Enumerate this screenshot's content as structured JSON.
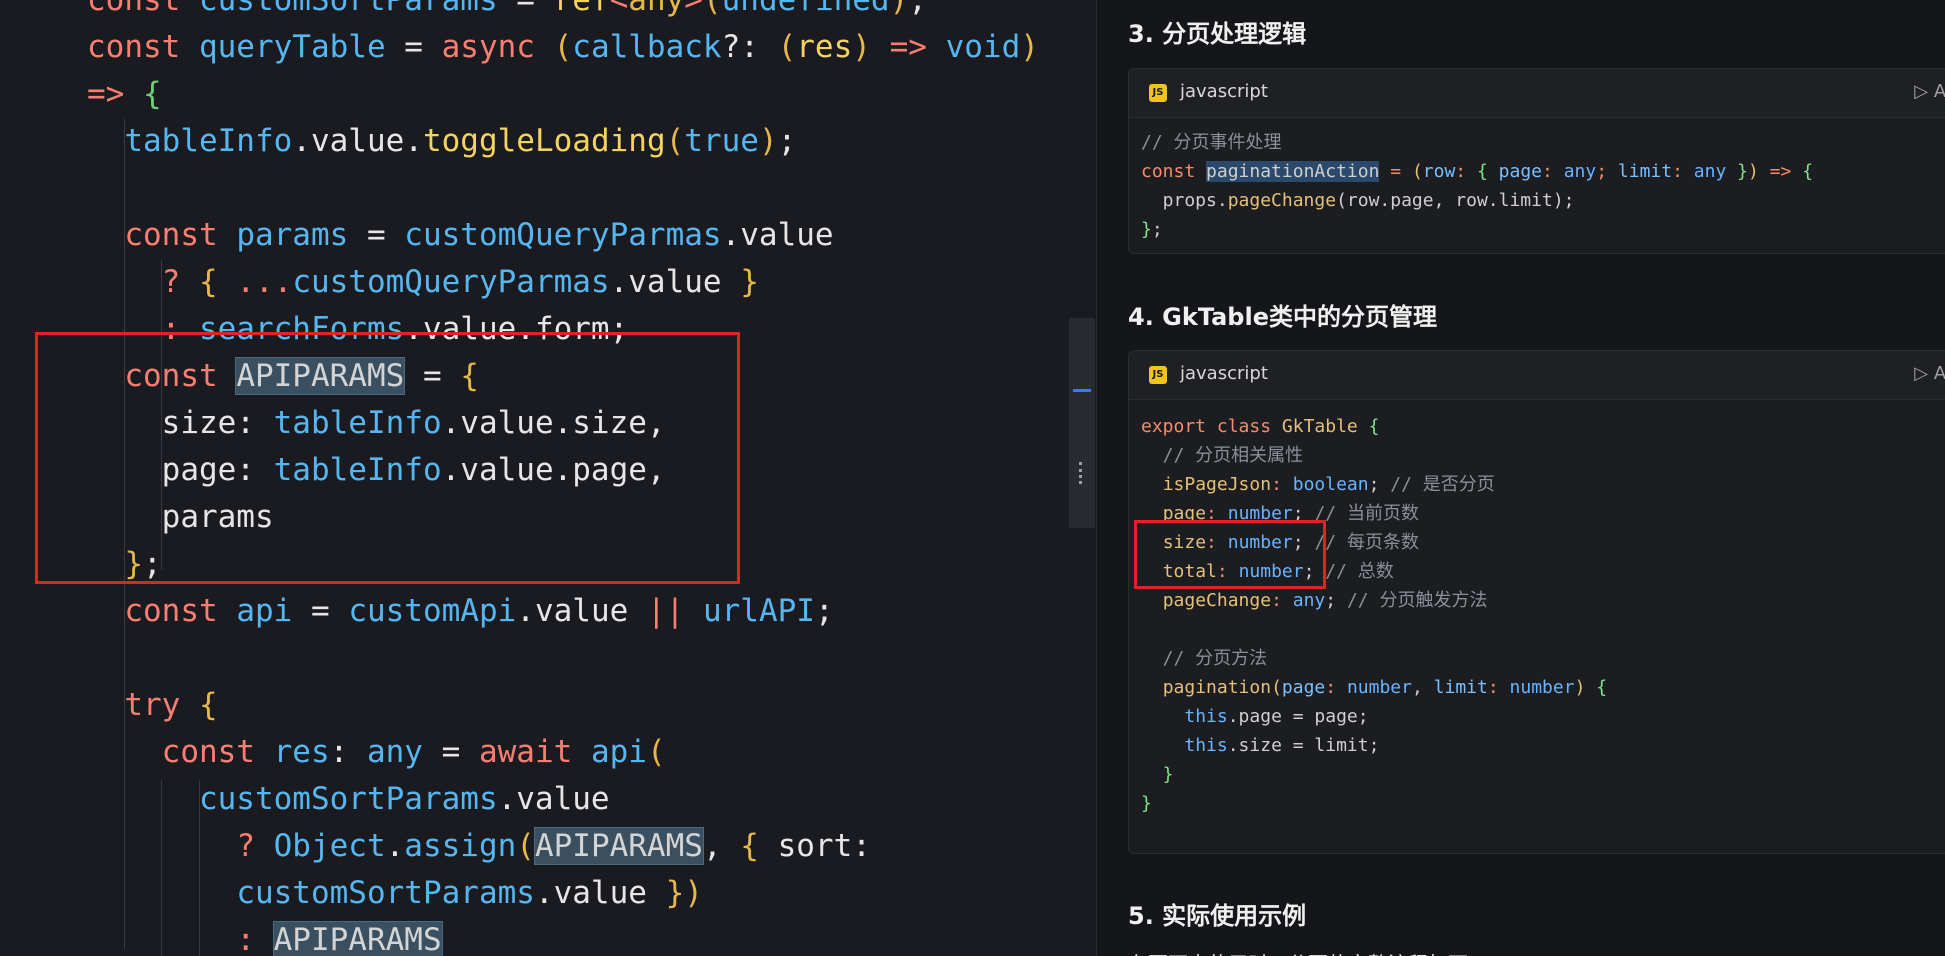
{
  "editor": {
    "lines": [
      [
        [
          "kw",
          "const "
        ],
        [
          "blue",
          "customSortParams"
        ],
        [
          "wh",
          " = "
        ],
        [
          "yel",
          "ref"
        ],
        [
          "kw",
          "<"
        ],
        [
          "gold",
          "any"
        ],
        [
          "kw",
          ">"
        ],
        [
          "gold",
          "("
        ],
        [
          "blue",
          "undefined"
        ],
        [
          "gold",
          ")"
        ],
        [
          "wh",
          ";"
        ]
      ],
      [
        [
          "kw",
          "const "
        ],
        [
          "blue",
          "queryTable"
        ],
        [
          "wh",
          " = "
        ],
        [
          "kw",
          "async "
        ],
        [
          "gold",
          "("
        ],
        [
          "blue",
          "callback"
        ],
        [
          "wh",
          "?: "
        ],
        [
          "gold",
          "("
        ],
        [
          "yel",
          "res"
        ],
        [
          "gold",
          ")"
        ],
        [
          "kw",
          " => "
        ],
        [
          "blue",
          "void"
        ],
        [
          "gold",
          ")"
        ]
      ],
      [
        [
          "kw",
          "=> "
        ],
        [
          "green",
          "{"
        ]
      ],
      [
        [
          "wh",
          "  "
        ],
        [
          "blue",
          "tableInfo"
        ],
        [
          "wh",
          "."
        ],
        [
          "wh",
          "value"
        ],
        [
          "wh",
          "."
        ],
        [
          "yel",
          "toggleLoading"
        ],
        [
          "gold",
          "("
        ],
        [
          "blue",
          "true"
        ],
        [
          "gold",
          ")"
        ],
        [
          "wh",
          ";"
        ]
      ],
      [],
      [
        [
          "wh",
          "  "
        ],
        [
          "kw",
          "const "
        ],
        [
          "blue",
          "params"
        ],
        [
          "wh",
          " = "
        ],
        [
          "blue",
          "customQueryParmas"
        ],
        [
          "wh",
          ".value"
        ]
      ],
      [
        [
          "wh",
          "    "
        ],
        [
          "kw",
          "? "
        ],
        [
          "gold",
          "{ "
        ],
        [
          "kw",
          "..."
        ],
        [
          "blue",
          "customQueryParmas"
        ],
        [
          "wh",
          ".value "
        ],
        [
          "gold",
          "}"
        ]
      ],
      [
        [
          "wh",
          "    "
        ],
        [
          "kw",
          ": "
        ],
        [
          "blue",
          "searchForms"
        ],
        [
          "wh",
          ".value.form;"
        ]
      ],
      [
        [
          "wh",
          "  "
        ],
        [
          "kw",
          "const "
        ],
        [
          "hl-box",
          "APIPARAMS"
        ],
        [
          "wh",
          " = "
        ],
        [
          "gold",
          "{"
        ]
      ],
      [
        [
          "wh",
          "    "
        ],
        [
          "wh",
          "size: "
        ],
        [
          "blue",
          "tableInfo"
        ],
        [
          "wh",
          ".value.size,"
        ]
      ],
      [
        [
          "wh",
          "    "
        ],
        [
          "wh",
          "page: "
        ],
        [
          "blue",
          "tableInfo"
        ],
        [
          "wh",
          ".value.page,"
        ]
      ],
      [
        [
          "wh",
          "    "
        ],
        [
          "wh",
          "params"
        ]
      ],
      [
        [
          "wh",
          "  "
        ],
        [
          "gold",
          "}"
        ],
        [
          "wh",
          ";"
        ]
      ],
      [
        [
          "wh",
          "  "
        ],
        [
          "kw",
          "const "
        ],
        [
          "blue",
          "api"
        ],
        [
          "wh",
          " = "
        ],
        [
          "blue",
          "customApi"
        ],
        [
          "wh",
          ".value "
        ],
        [
          "kw",
          "|| "
        ],
        [
          "blue",
          "urlAPI"
        ],
        [
          "wh",
          ";"
        ]
      ],
      [],
      [
        [
          "wh",
          "  "
        ],
        [
          "kw",
          "try "
        ],
        [
          "gold",
          "{"
        ]
      ],
      [
        [
          "wh",
          "    "
        ],
        [
          "kw",
          "const "
        ],
        [
          "blue",
          "res"
        ],
        [
          "wh",
          ": "
        ],
        [
          "blue",
          "any"
        ],
        [
          "wh",
          " = "
        ],
        [
          "kw",
          "await "
        ],
        [
          "blue",
          "api"
        ],
        [
          "gold",
          "("
        ]
      ],
      [
        [
          "wh",
          "      "
        ],
        [
          "blue",
          "customSortParams"
        ],
        [
          "wh",
          ".value"
        ]
      ],
      [
        [
          "wh",
          "        "
        ],
        [
          "kw",
          "? "
        ],
        [
          "blue",
          "Object"
        ],
        [
          "wh",
          "."
        ],
        [
          "blue",
          "assign"
        ],
        [
          "gold",
          "("
        ],
        [
          "hl-box",
          "APIPARAMS"
        ],
        [
          "wh",
          ", "
        ],
        [
          "gold",
          "{ "
        ],
        [
          "wh",
          "sort:"
        ]
      ],
      [
        [
          "wh",
          "        "
        ],
        [
          "blue",
          "customSortParams"
        ],
        [
          "wh",
          ".value "
        ],
        [
          "gold",
          "})"
        ]
      ],
      [
        [
          "wh",
          "        "
        ],
        [
          "kw",
          ": "
        ],
        [
          "hl-box",
          "APIPARAMS"
        ]
      ]
    ]
  },
  "doc": {
    "section3": {
      "title": "3. 分页处理逻辑"
    },
    "section4": {
      "title": "4. GkTable类中的分页管理"
    },
    "section5": {
      "title": "5. 实际使用示例"
    },
    "section5_text": "在页面中使用时，分页的完整流程如下：",
    "card1": {
      "lang": "javascript",
      "apply": "▷ App",
      "lines": [
        [
          [
            "cm",
            "// 分页事件处理"
          ]
        ],
        [
          [
            "dkw",
            "const "
          ],
          [
            "dhl",
            "paginationAction"
          ],
          [
            "dkw",
            " = "
          ],
          [
            "dyel",
            "("
          ],
          [
            "dcyan",
            "row"
          ],
          [
            "dkw",
            ": "
          ],
          [
            "dgreen",
            "{ "
          ],
          [
            "dcyan",
            "page"
          ],
          [
            "dkw",
            ": "
          ],
          [
            "dblue",
            "any"
          ],
          [
            "dkw",
            "; "
          ],
          [
            "dcyan",
            "limit"
          ],
          [
            "dkw",
            ": "
          ],
          [
            "dblue",
            "any "
          ],
          [
            "dgreen",
            "}"
          ],
          [
            "dyel",
            ")"
          ],
          [
            "dkw",
            " => "
          ],
          [
            "dgreen",
            "{"
          ]
        ],
        [
          [
            "x",
            "  props."
          ],
          [
            "dyel",
            "pageChange"
          ],
          [
            "x",
            "(row.page, row.limit);"
          ]
        ],
        [
          [
            "dgreen",
            "}"
          ],
          [
            "x",
            ";"
          ]
        ]
      ]
    },
    "card2": {
      "lang": "javascript",
      "apply": "▷ App",
      "lines": [
        [
          [
            "dkw",
            "export class "
          ],
          [
            "dyel",
            "GkTable "
          ],
          [
            "dgreen",
            "{"
          ]
        ],
        [
          [
            "cm",
            "  // 分页相关属性"
          ]
        ],
        [
          [
            "x",
            "  "
          ],
          [
            "dyel",
            "isPageJson"
          ],
          [
            "dkw",
            ": "
          ],
          [
            "dblue",
            "boolean"
          ],
          [
            "x",
            "; "
          ],
          [
            "cm",
            "// 是否分页"
          ]
        ],
        [
          [
            "x",
            "  "
          ],
          [
            "dyel",
            "page"
          ],
          [
            "dkw",
            ": "
          ],
          [
            "dblue",
            "number"
          ],
          [
            "x",
            "; "
          ],
          [
            "cm",
            "// 当前页数"
          ]
        ],
        [
          [
            "x",
            "  "
          ],
          [
            "dyel",
            "size"
          ],
          [
            "dkw",
            ": "
          ],
          [
            "dblue",
            "number"
          ],
          [
            "x",
            "; "
          ],
          [
            "cm",
            "// 每页条数"
          ]
        ],
        [
          [
            "x",
            "  "
          ],
          [
            "dyel",
            "total"
          ],
          [
            "dkw",
            ": "
          ],
          [
            "dblue",
            "number"
          ],
          [
            "x",
            "; "
          ],
          [
            "cm",
            "// 总数"
          ]
        ],
        [
          [
            "x",
            "  "
          ],
          [
            "dyel",
            "pageChange"
          ],
          [
            "dkw",
            ": "
          ],
          [
            "dblue",
            "any"
          ],
          [
            "x",
            "; "
          ],
          [
            "cm",
            "// 分页触发方法"
          ]
        ],
        [],
        [
          [
            "cm",
            "  // 分页方法"
          ]
        ],
        [
          [
            "x",
            "  "
          ],
          [
            "dyel",
            "pagination"
          ],
          [
            "dyel",
            "("
          ],
          [
            "dcyan",
            "page"
          ],
          [
            "dkw",
            ": "
          ],
          [
            "dblue",
            "number"
          ],
          [
            "x",
            ", "
          ],
          [
            "dcyan",
            "limit"
          ],
          [
            "dkw",
            ": "
          ],
          [
            "dblue",
            "number"
          ],
          [
            "dyel",
            ") "
          ],
          [
            "dgreen",
            "{"
          ]
        ],
        [
          [
            "x",
            "    "
          ],
          [
            "dblue",
            "this"
          ],
          [
            "x",
            ".page = page;"
          ]
        ],
        [
          [
            "x",
            "    "
          ],
          [
            "dblue",
            "this"
          ],
          [
            "x",
            ".size = limit;"
          ]
        ],
        [
          [
            "dgreen",
            "  }"
          ]
        ],
        [
          [
            "dgreen",
            "}"
          ]
        ]
      ]
    }
  }
}
